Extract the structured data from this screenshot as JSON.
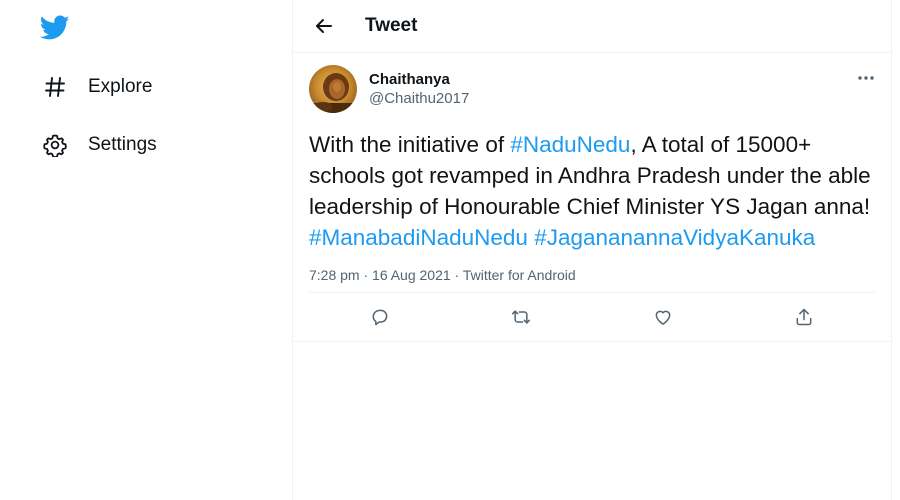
{
  "sidebar": {
    "logo_icon": "twitter-bird-icon",
    "items": [
      {
        "label": "Explore",
        "icon": "hashtag-icon"
      },
      {
        "label": "Settings",
        "icon": "gear-icon"
      }
    ]
  },
  "header": {
    "title": "Tweet",
    "back_icon": "back-arrow-icon"
  },
  "tweet": {
    "author_name": "Chaithanya",
    "author_handle": "@Chaithu2017",
    "text_parts": [
      "With the initiative of ",
      "#NaduNedu",
      ", A total of 15000+ schools got revamped in Andhra Pradesh under the able leadership of Honourable Chief Minister YS Jagan anna!  ",
      "#ManabadiNaduNedu",
      " ",
      "#JagananannaVidyaKanuka"
    ],
    "timestamp": "7:28 pm · 16 Aug 2021 · ",
    "source": "Twitter for Android",
    "actions": [
      "reply-icon",
      "retweet-icon",
      "like-icon",
      "share-icon"
    ]
  },
  "colors": {
    "brand": "#1d9bf0",
    "text": "#0f1419",
    "muted": "#536471",
    "border": "#eff3f4"
  }
}
